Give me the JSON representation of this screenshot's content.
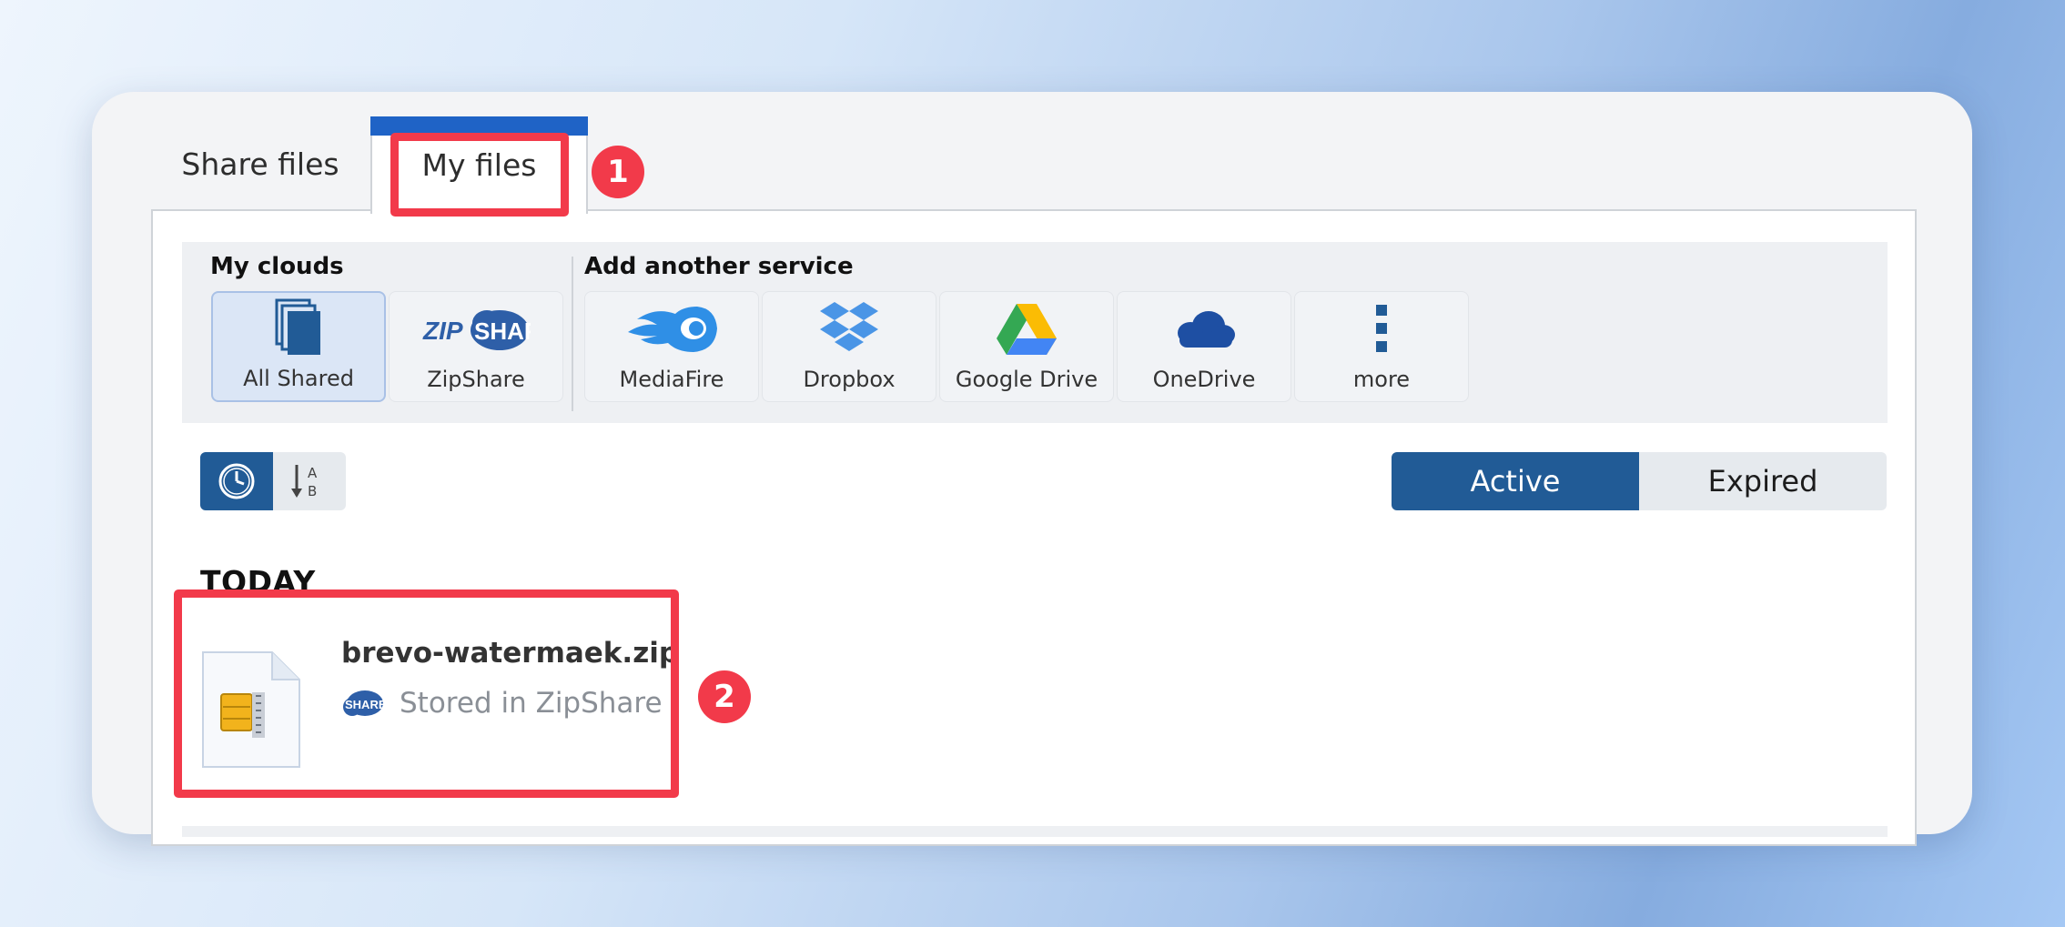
{
  "tabs": [
    {
      "label": "Share files",
      "selected": false
    },
    {
      "label": "My files",
      "selected": true
    }
  ],
  "services": {
    "my_clouds_heading": "My clouds",
    "add_heading": "Add another service",
    "my_clouds": [
      {
        "label": "All Shared",
        "icon": "stacked-pages-icon",
        "selected": true
      },
      {
        "label": "ZipShare",
        "icon": "zipshare-logo"
      }
    ],
    "available": [
      {
        "label": "MediaFire",
        "icon": "mediafire-logo"
      },
      {
        "label": "Dropbox",
        "icon": "dropbox-logo"
      },
      {
        "label": "Google Drive",
        "icon": "google-drive-logo"
      },
      {
        "label": "OneDrive",
        "icon": "onedrive-logo"
      },
      {
        "label": "more",
        "icon": "vertical-ellipsis-icon"
      }
    ],
    "zipshare_logo_text": {
      "zip": "ZIP",
      "share": "SHARE"
    }
  },
  "sort": {
    "options": [
      {
        "name": "time",
        "icon": "clock-icon",
        "selected": true
      },
      {
        "name": "alphabetical",
        "icon": "sort-alpha-icon",
        "letters": [
          "A",
          "B"
        ],
        "selected": false
      }
    ]
  },
  "status_filter": {
    "active_label": "Active",
    "expired_label": "Expired",
    "selected": "Active"
  },
  "files": {
    "section_title": "TODAY",
    "items": [
      {
        "name": "brevo-watermaek.zip",
        "location": "Stored in ZipShare",
        "icon": "zip-file-icon",
        "location_icon": "zipshare-cloud-icon",
        "location_icon_text": "SHARE"
      }
    ]
  },
  "annotations": [
    {
      "number": "1"
    },
    {
      "number": "2"
    }
  ],
  "colors": {
    "accent": "#215b96",
    "tab_accent": "#1f63c6",
    "highlight": "#f23a4a"
  }
}
